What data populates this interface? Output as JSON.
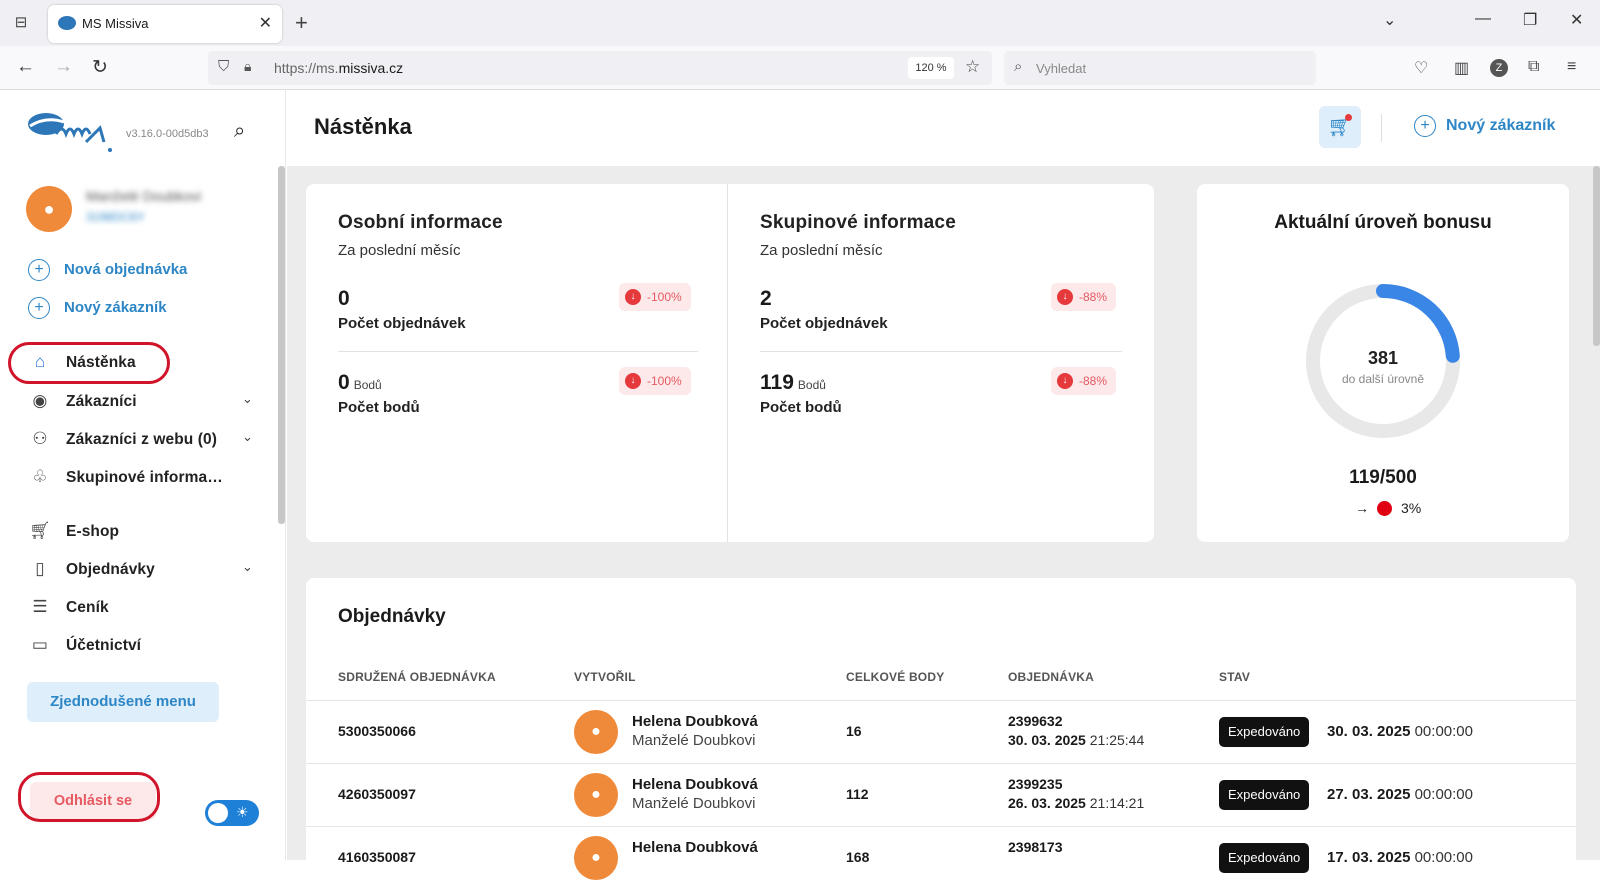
{
  "browser": {
    "tab_title": "MS Missiva",
    "url_prefix": "https://ms.",
    "url_domain": "missiva.cz",
    "zoom": "120 %",
    "search_placeholder": "Vyhledat"
  },
  "sidebar": {
    "version": "v3.16.0-00d5db3",
    "user_name": "Manželé Doubkovi",
    "user_id": "3198DC6Y",
    "quick_actions": [
      "Nová objednávka",
      "Nový zákazník"
    ],
    "nav": {
      "dashboard": "Nástěnka",
      "customers": "Zákazníci",
      "web_customers": "Zákazníci z webu (0)",
      "group_info": "Skupinové informa…",
      "eshop": "E-shop",
      "orders": "Objednávky",
      "pricelist": "Ceník",
      "accounting": "Účetnictví"
    },
    "simple_menu": "Zjednodušené menu",
    "logout": "Odhlásit se"
  },
  "header": {
    "title": "Nástěnka",
    "new_customer": "Nový zákazník"
  },
  "personal": {
    "title": "Osobní informace",
    "subtitle": "Za poslední měsíc",
    "orders_value": "0",
    "orders_label": "Počet objednávek",
    "orders_change": "-100%",
    "points_value": "0",
    "points_unit": "Bodů",
    "points_label": "Počet bodů",
    "points_change": "-100%"
  },
  "group": {
    "title": "Skupinové informace",
    "subtitle": "Za poslední měsíc",
    "orders_value": "2",
    "orders_label": "Počet objednávek",
    "orders_change": "-88%",
    "points_value": "119",
    "points_unit": "Bodů",
    "points_label": "Počet bodů",
    "points_change": "-88%"
  },
  "bonus": {
    "title": "Aktuální úroveň bonusu",
    "remaining": "381",
    "remaining_label": "do další úrovně",
    "ratio": "119/500",
    "progress_fraction": 0.238,
    "next_level": "3%",
    "next_level_color": "#e00012",
    "ring_color": "#3a86e6"
  },
  "orders": {
    "title": "Objednávky",
    "columns": [
      "SDRUŽENÁ OBJEDNÁVKA",
      "VYTVOŘIL",
      "CELKOVÉ BODY",
      "OBJEDNÁVKA",
      "STAV"
    ],
    "rows": [
      {
        "group_id": "5300350066",
        "creator": "Helena Doubková",
        "creator_sub": "Manželé Doubkovi",
        "points": "16",
        "order_id": "2399632",
        "order_date": "30. 03. 2025",
        "order_time": "21:25:44",
        "status": "Expedováno",
        "status_date": "30. 03. 2025",
        "status_time": "00:00:00"
      },
      {
        "group_id": "4260350097",
        "creator": "Helena Doubková",
        "creator_sub": "Manželé Doubkovi",
        "points": "112",
        "order_id": "2399235",
        "order_date": "26. 03. 2025",
        "order_time": "21:14:21",
        "status": "Expedováno",
        "status_date": "27. 03. 2025",
        "status_time": "00:00:00"
      },
      {
        "group_id": "4160350087",
        "creator": "Helena Doubková",
        "creator_sub": "",
        "points": "168",
        "order_id": "2398173",
        "order_date": "",
        "order_time": "",
        "status": "Expedováno",
        "status_date": "17. 03. 2025",
        "status_time": "00:00:00"
      }
    ]
  },
  "colors": {
    "accent": "#2d86c6",
    "danger": "#e65a62",
    "avatar": "#f08a3b",
    "highlight": "#d0152b"
  },
  "icons": [
    "tab-list-icon",
    "missiva-favicon",
    "close-icon",
    "plus-icon",
    "chevron-down-icon",
    "minimize-icon",
    "restore-icon",
    "back-arrow-icon",
    "forward-arrow-icon",
    "reload-icon",
    "shield-icon",
    "lock-icon",
    "star-icon",
    "search-icon",
    "pocket-icon",
    "library-icon",
    "account-icon",
    "extensions-icon",
    "menu-icon",
    "user-icon",
    "home-icon",
    "people-icon",
    "tree-icon",
    "cart-icon",
    "document-icon",
    "clipboard-icon",
    "folder-icon",
    "sun-icon",
    "arrow-down-icon",
    "arrow-right-icon"
  ]
}
